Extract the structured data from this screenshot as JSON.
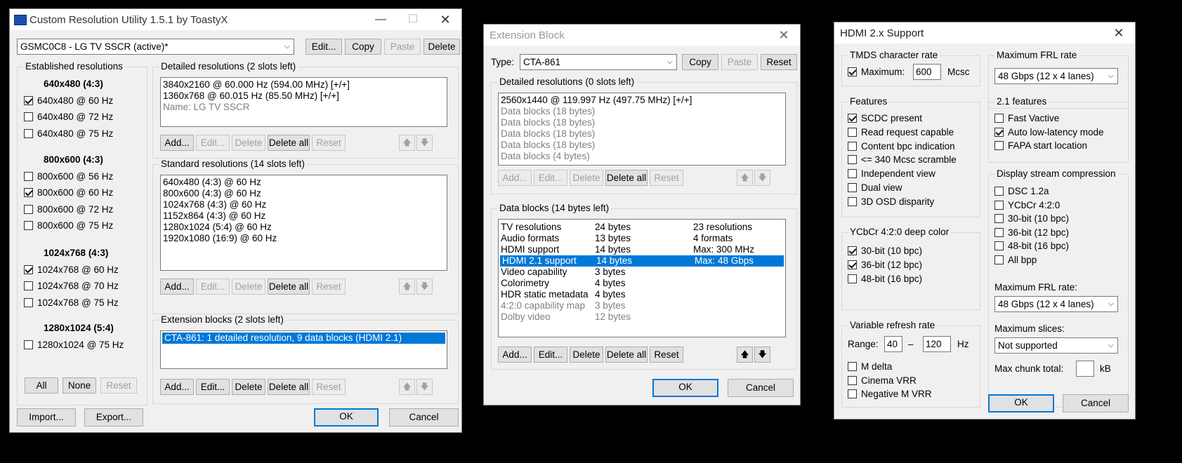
{
  "cru": {
    "title": "Custom Resolution Utility 1.5.1 by ToastyX",
    "display_combo": "GSMC0C8 - LG TV SSCR (active)*",
    "buttons": {
      "edit": "Edit...",
      "copy": "Copy",
      "paste": "Paste",
      "delete": "Delete"
    },
    "established": {
      "label": "Established resolutions",
      "groups": [
        {
          "heading": "640x480 (4:3)",
          "items": [
            {
              "label": "640x480 @ 60 Hz",
              "checked": true
            },
            {
              "label": "640x480 @ 72 Hz",
              "checked": false
            },
            {
              "label": "640x480 @ 75 Hz",
              "checked": false
            }
          ]
        },
        {
          "heading": "800x600 (4:3)",
          "items": [
            {
              "label": "800x600 @ 56 Hz",
              "checked": false
            },
            {
              "label": "800x600 @ 60 Hz",
              "checked": true
            },
            {
              "label": "800x600 @ 72 Hz",
              "checked": false
            },
            {
              "label": "800x600 @ 75 Hz",
              "checked": false
            }
          ]
        },
        {
          "heading": "1024x768 (4:3)",
          "items": [
            {
              "label": "1024x768 @ 60 Hz",
              "checked": true
            },
            {
              "label": "1024x768 @ 70 Hz",
              "checked": false
            },
            {
              "label": "1024x768 @ 75 Hz",
              "checked": false
            }
          ]
        },
        {
          "heading": "1280x1024 (5:4)",
          "items": [
            {
              "label": "1280x1024 @ 75 Hz",
              "checked": false
            }
          ]
        }
      ],
      "btn_all": "All",
      "btn_none": "None",
      "btn_reset": "Reset"
    },
    "detailed": {
      "label": "Detailed resolutions (2 slots left)",
      "items": [
        "3840x2160 @ 60.000 Hz (594.00 MHz) [+/+]",
        "1360x768 @ 60.015 Hz (85.50 MHz) [+/+]"
      ],
      "name_item": "Name: LG TV SSCR"
    },
    "standard": {
      "label": "Standard resolutions (14 slots left)",
      "items": [
        "640x480 (4:3) @ 60 Hz",
        "800x600 (4:3) @ 60 Hz",
        "1024x768 (4:3) @ 60 Hz",
        "1152x864 (4:3) @ 60 Hz",
        "1280x1024 (5:4) @ 60 Hz",
        "1920x1080 (16:9) @ 60 Hz"
      ]
    },
    "extension": {
      "label": "Extension blocks (2 slots left)",
      "items": [
        "CTA-861: 1 detailed resolution, 9 data blocks (HDMI 2.1)"
      ]
    },
    "row_buttons": {
      "add": "Add...",
      "edit": "Edit...",
      "delete": "Delete",
      "delete_all": "Delete all",
      "reset": "Reset",
      "up": "🡅",
      "down": "🡇"
    },
    "import": "Import...",
    "export": "Export...",
    "ok": "OK",
    "cancel": "Cancel"
  },
  "ext": {
    "title": "Extension Block",
    "type_label": "Type:",
    "type_value": "CTA-861",
    "copy": "Copy",
    "paste": "Paste",
    "reset": "Reset",
    "detailed": {
      "label": "Detailed resolutions (0 slots left)",
      "items": [
        {
          "text": "2560x1440 @ 119.997 Hz (497.75 MHz) [+/+]",
          "grey": false
        },
        {
          "text": "Data blocks (18 bytes)",
          "grey": true
        },
        {
          "text": "Data blocks (18 bytes)",
          "grey": true
        },
        {
          "text": "Data blocks (18 bytes)",
          "grey": true
        },
        {
          "text": "Data blocks (18 bytes)",
          "grey": true
        },
        {
          "text": "Data blocks (4 bytes)",
          "grey": true
        }
      ]
    },
    "datablocks": {
      "label": "Data blocks (14 bytes left)",
      "rows": [
        {
          "name": "TV resolutions",
          "size": "24 bytes",
          "info": "23 resolutions",
          "grey": false,
          "selected": false
        },
        {
          "name": "Audio formats",
          "size": "13 bytes",
          "info": "4 formats",
          "grey": false,
          "selected": false
        },
        {
          "name": "HDMI support",
          "size": "14 bytes",
          "info": "Max: 300 MHz",
          "grey": false,
          "selected": false
        },
        {
          "name": "HDMI 2.1 support",
          "size": "14 bytes",
          "info": "Max: 48 Gbps",
          "grey": false,
          "selected": true
        },
        {
          "name": "Video capability",
          "size": "3 bytes",
          "info": "",
          "grey": false,
          "selected": false
        },
        {
          "name": "Colorimetry",
          "size": "4 bytes",
          "info": "",
          "grey": false,
          "selected": false
        },
        {
          "name": "HDR static metadata",
          "size": "4 bytes",
          "info": "",
          "grey": false,
          "selected": false
        },
        {
          "name": "4:2:0 capability map",
          "size": "3 bytes",
          "info": "",
          "grey": true,
          "selected": false
        },
        {
          "name": "Dolby video",
          "size": "12 bytes",
          "info": "",
          "grey": true,
          "selected": false
        }
      ]
    },
    "ok": "OK",
    "cancel": "Cancel"
  },
  "hdmi": {
    "title": "HDMI 2.x Support",
    "tmds": {
      "label": "TMDS character rate",
      "max_label": "Maximum:",
      "max_checked": true,
      "value": "600",
      "unit": "Mcsc"
    },
    "features": {
      "label": "Features",
      "items": [
        {
          "label": "SCDC present",
          "checked": true
        },
        {
          "label": "Read request capable",
          "checked": false
        },
        {
          "label": "Content bpc indication",
          "checked": false
        },
        {
          "label": "<= 340 Mcsc scramble",
          "checked": false
        },
        {
          "label": "Independent view",
          "checked": false
        },
        {
          "label": "Dual view",
          "checked": false
        },
        {
          "label": "3D OSD disparity",
          "checked": false
        }
      ]
    },
    "ycbcr": {
      "label": "YCbCr 4:2:0 deep color",
      "items": [
        {
          "label": "30-bit (10 bpc)",
          "checked": true
        },
        {
          "label": "36-bit (12 bpc)",
          "checked": true
        },
        {
          "label": "48-bit (16 bpc)",
          "checked": false
        }
      ]
    },
    "vrr": {
      "label": "Variable refresh rate",
      "range_label": "Range:",
      "min": "40",
      "dash": "–",
      "max": "120",
      "unit": "Hz",
      "items": [
        {
          "label": "M delta",
          "checked": false
        },
        {
          "label": "Cinema VRR",
          "checked": false
        },
        {
          "label": "Negative M VRR",
          "checked": false
        }
      ]
    },
    "frl": {
      "label": "Maximum FRL rate",
      "value": "48 Gbps (12 x 4 lanes)"
    },
    "f21": {
      "label": "2.1 features",
      "items": [
        {
          "label": "Fast Vactive",
          "checked": false
        },
        {
          "label": "Auto low-latency mode",
          "checked": true
        },
        {
          "label": "FAPA start location",
          "checked": false
        }
      ]
    },
    "dsc": {
      "label": "Display stream compression",
      "items": [
        {
          "label": "DSC 1.2a",
          "checked": false
        },
        {
          "label": "YCbCr 4:2:0",
          "checked": false
        },
        {
          "label": "30-bit (10 bpc)",
          "checked": false
        },
        {
          "label": "36-bit (12 bpc)",
          "checked": false
        },
        {
          "label": "48-bit (16 bpc)",
          "checked": false
        },
        {
          "label": "All bpp",
          "checked": false
        }
      ],
      "frl_label": "Maximum FRL rate:",
      "frl_value": "48 Gbps (12 x 4 lanes)",
      "slices_label": "Maximum slices:",
      "slices_value": "Not supported",
      "chunk_label": "Max chunk total:",
      "chunk_value": "",
      "chunk_unit": "kB"
    },
    "ok": "OK",
    "cancel": "Cancel"
  }
}
